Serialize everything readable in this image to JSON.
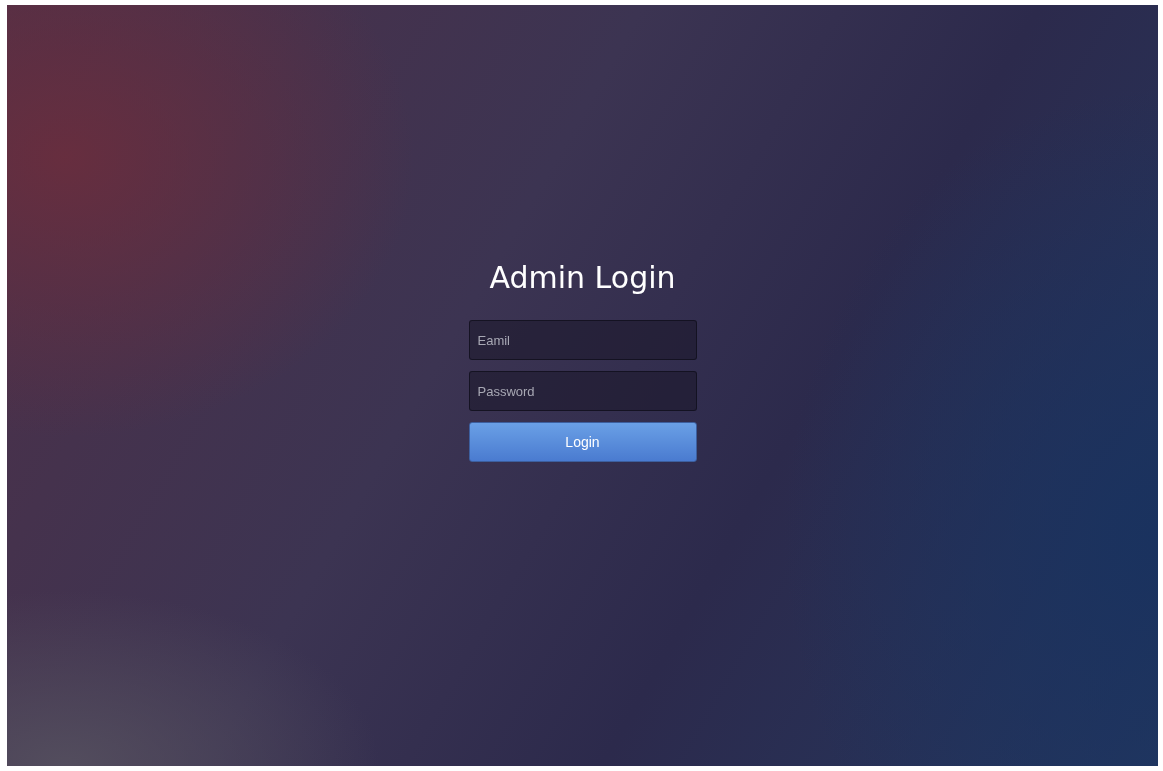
{
  "title": "Admin Login",
  "fields": [
    {
      "placeholder": "Eamil"
    },
    {
      "placeholder": "Password"
    }
  ],
  "button": {
    "label": "Login"
  }
}
